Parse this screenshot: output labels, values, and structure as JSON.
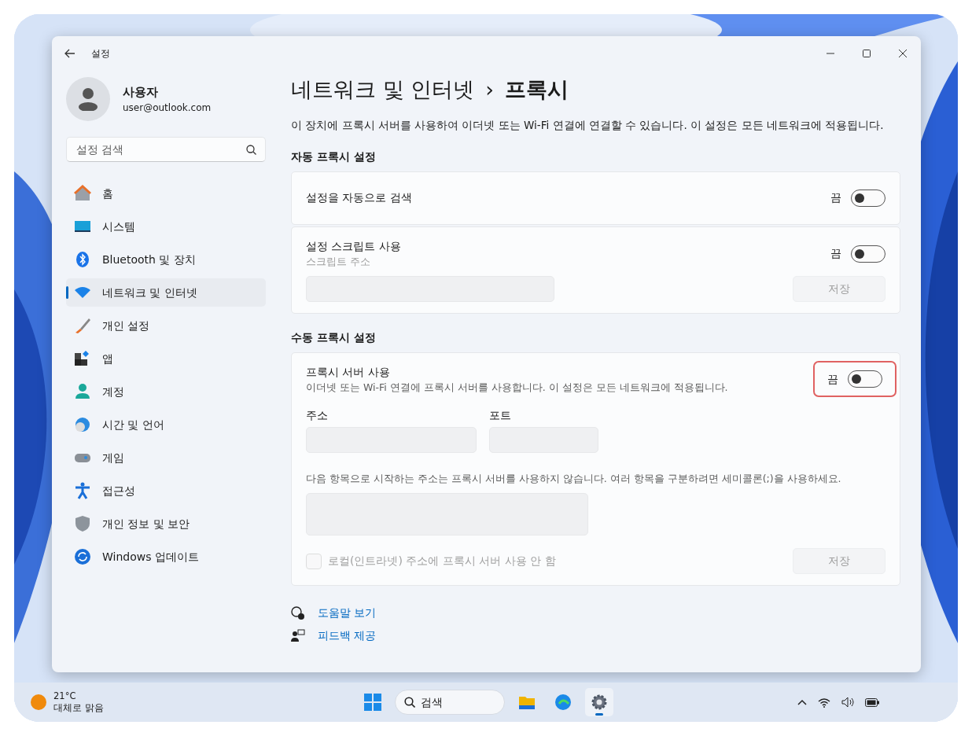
{
  "window": {
    "title": "설정"
  },
  "user": {
    "name": "사용자",
    "email": "user@outlook.com"
  },
  "search": {
    "placeholder": "설정 검색"
  },
  "sidebar": {
    "items": [
      {
        "label": "홈",
        "kind": "home",
        "selected": false
      },
      {
        "label": "시스템",
        "kind": "system",
        "selected": false
      },
      {
        "label": "Bluetooth 및 장치",
        "kind": "bluetooth",
        "selected": false
      },
      {
        "label": "네트워크 및 인터넷",
        "kind": "network",
        "selected": true
      },
      {
        "label": "개인 설정",
        "kind": "personalize",
        "selected": false
      },
      {
        "label": "앱",
        "kind": "apps",
        "selected": false
      },
      {
        "label": "계정",
        "kind": "account",
        "selected": false
      },
      {
        "label": "시간 및 언어",
        "kind": "time",
        "selected": false
      },
      {
        "label": "게임",
        "kind": "gaming",
        "selected": false
      },
      {
        "label": "접근성",
        "kind": "accessibility",
        "selected": false
      },
      {
        "label": "개인 정보 및 보안",
        "kind": "privacy",
        "selected": false
      },
      {
        "label": "Windows 업데이트",
        "kind": "update",
        "selected": false
      }
    ]
  },
  "breadcrumb": {
    "parent": "네트워크 및 인터넷",
    "separator": "›",
    "current": "프록시"
  },
  "description": "이 장치에 프록시 서버를 사용하여 이더넷 또는 Wi-Fi 연결에 연결할 수 있습니다. 이 설정은 모든 네트워크에 적용됩니다.",
  "sections": [
    {
      "title": "자동 프록시 설정",
      "cards": [
        {
          "kind": "toggle",
          "label": "설정을 자동으로 검색",
          "state_text": "끔",
          "on": false,
          "highlighted": false
        },
        {
          "kind": "script",
          "label": "설정 스크립트 사용",
          "sublabel": "스크립트 주소",
          "state_text": "끔",
          "on": false,
          "highlighted": false,
          "save": {
            "label": "저장",
            "disabled": true
          }
        }
      ]
    },
    {
      "title": "수동 프록시 설정",
      "cards": [
        {
          "kind": "manual",
          "label": "프록시 서버 사용",
          "sublabel": "이더넷 또는 Wi-Fi 연결에 프록시 서버를 사용합니다. 이 설정은 모든 네트워크에 적용됩니다.",
          "state_text": "끔",
          "on": false,
          "highlighted": true,
          "address_label": "주소",
          "port_label": "포트",
          "exceptions_label": "다음 항목으로 시작하는 주소는 프록시 서버를 사용하지 않습니다. 여러 항목을 구분하려면 세미콜론(;)을 사용하세요.",
          "checkbox": {
            "label": "로컬(인트라넷) 주소에 프록시 서버 사용 안 함",
            "checked": false,
            "disabled": true
          },
          "save": {
            "label": "저장",
            "disabled": true
          }
        }
      ]
    }
  ],
  "links": [
    {
      "label": "도움말 보기",
      "kind": "help"
    },
    {
      "label": "피드백 제공",
      "kind": "feedback"
    }
  ],
  "taskbar": {
    "weather": {
      "temp": "21°C",
      "condition": "대체로 맑음"
    },
    "search": {
      "placeholder": "검색"
    },
    "apps": [
      {
        "kind": "explorer",
        "selected": false
      },
      {
        "kind": "edge",
        "selected": false
      },
      {
        "kind": "settings",
        "selected": true
      }
    ]
  }
}
